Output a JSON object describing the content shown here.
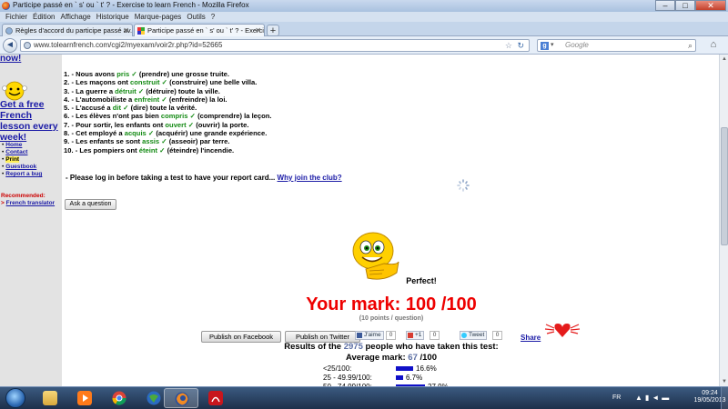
{
  "window": {
    "title": "Participe passé en ` s' ou ` t' ? - Exercise to learn French - Mozilla Firefox",
    "buttons": {
      "minimize": "–",
      "maximize": "□",
      "close": "✕"
    }
  },
  "menu": [
    "Fichier",
    "Édition",
    "Affichage",
    "Historique",
    "Marque-pages",
    "Outils",
    "?"
  ],
  "tabs": [
    {
      "label": "Règles d'accord du participe passé av...",
      "active": false
    },
    {
      "label": "Participe passé en ` s' ou ` t' ? - Exercis...",
      "active": true
    }
  ],
  "new_tab": "+",
  "nav": {
    "url": "www.tolearnfrench.com/cgi2/myexam/voir2r.php?id=52665",
    "search_placeholder": "Google",
    "search_engine": "g",
    "back_icon": "◄",
    "home_icon": "⌂"
  },
  "sidebar": {
    "now": "now!",
    "promo": "Get a free French lesson every week!",
    "links": [
      "Home",
      "Contact",
      "Print",
      "Guestbook",
      "Report a bug"
    ],
    "recommended_label": "Recommended:",
    "recommended_link": "French translator",
    "recommended_prefix": ">"
  },
  "exercise": {
    "sentences": [
      {
        "n": "1.",
        "before": "- Nous avons ",
        "answer": "pris",
        "after": " (prendre) une grosse truite."
      },
      {
        "n": "2.",
        "before": "- Les maçons ont ",
        "answer": "construit",
        "after": " (construire) une belle villa."
      },
      {
        "n": "3.",
        "before": "- La guerre a ",
        "answer": "détruit",
        "after": " (détruire) toute la ville."
      },
      {
        "n": "4.",
        "before": "- L'automobiliste a ",
        "answer": "enfreint",
        "after": " (enfreindre) la loi."
      },
      {
        "n": "5.",
        "before": "- L'accusé a ",
        "answer": "dit",
        "after": " (dire) toute la vérité."
      },
      {
        "n": "6.",
        "before": "- Les élèves n'ont pas bien ",
        "answer": "compris",
        "after": " (comprendre) la leçon."
      },
      {
        "n": "7.",
        "before": "- Pour sortir, les enfants ont ",
        "answer": "ouvert",
        "after": " (ouvrir) la porte."
      },
      {
        "n": "8.",
        "before": "- Cet employé a ",
        "answer": "acquis",
        "after": " (acquérir) une grande expérience."
      },
      {
        "n": "9.",
        "before": "- Les enfants se sont ",
        "answer": "assis",
        "after": " (asseoir) par terre."
      },
      {
        "n": "10.",
        "before": "- Les pompiers ont ",
        "answer": "éteint",
        "after": " (éteindre) l'incendie."
      }
    ],
    "check": "✓",
    "login_note": "- Please log in before taking a test to have your report card... ",
    "join_link": "Why join the club?",
    "ask_button": "Ask a question"
  },
  "result": {
    "perfect": "Perfect!",
    "mark": "Your mark: 100 /100",
    "points": "(10 points / question)",
    "publish_facebook": "Publish on Facebook",
    "publish_twitter": "Publish on Twitter",
    "fb_like": "J'aime",
    "fb_count": "0",
    "gplus": "+1",
    "gplus_count": "0",
    "tweet": "Tweet",
    "tweet_count": "0",
    "share": "Share",
    "results_prefix": "Results of the ",
    "results_count": "2975",
    "results_suffix": " people who have taken this test:",
    "avg_prefix": "Average mark: ",
    "avg_value": "67",
    "avg_suffix": " /100",
    "distribution": [
      {
        "label": "<25/100:",
        "value": "16.6%",
        "fraction": 0.166
      },
      {
        "label": "25 - 49.99/100:",
        "value": "6.7%",
        "fraction": 0.067
      },
      {
        "label": "50 - 74.99/100:",
        "value": "27.9%",
        "fraction": 0.279
      }
    ]
  },
  "taskbar": {
    "apps": [
      "explorer",
      "media-player",
      "chrome",
      "google-earth",
      "firefox",
      "acrobat"
    ],
    "language": "FR",
    "time": "09:24",
    "date": "19/05/2013"
  },
  "colors": {
    "answer_green": "#138a13",
    "mark_red": "#ee0000",
    "link_blue": "#1a1aa6",
    "bar_blue": "#1010c8"
  }
}
